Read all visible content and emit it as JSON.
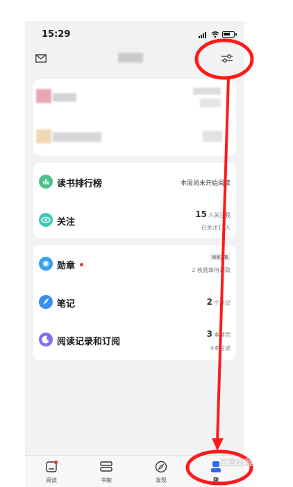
{
  "status_bar": {
    "time": "15:29"
  },
  "header": {
    "mail_icon": "mail-icon",
    "settings_icon": "settings-sliders-icon"
  },
  "menu_card_1": [
    {
      "label": "读书排行榜",
      "icon": "ranking-icon",
      "icon_color": "#4cc38a",
      "right_text": "本周尚未开始阅读"
    },
    {
      "label": "关注",
      "icon": "eye-icon",
      "icon_color": "#3ec9b6",
      "right_number": "15",
      "right_unit": "人关注我",
      "right_sub": "已关注13人"
    }
  ],
  "menu_card_2": [
    {
      "label": "勋章",
      "icon": "medal-icon",
      "icon_color": "#3aa0f0",
      "badge": "阅读天数",
      "right_sub": "2 枚勋章待领取",
      "has_red_dot": true
    },
    {
      "label": "笔记",
      "icon": "feather-icon",
      "icon_color": "#3b8ef0",
      "right_number": "2",
      "right_unit": "个笔记"
    },
    {
      "label": "阅读记录和订阅",
      "icon": "moon-icon",
      "icon_color": "#8a6cf0",
      "right_number": "3",
      "right_unit": "本读完",
      "right_sub": "4本在读"
    }
  ],
  "tab_bar": [
    {
      "label": "阅读",
      "icon": "reading-tablet-icon"
    },
    {
      "label": "书架",
      "icon": "bookshelf-icon"
    },
    {
      "label": "发现",
      "icon": "compass-icon"
    },
    {
      "label": "我",
      "icon": "profile-icon",
      "active": true
    }
  ],
  "colors": {
    "annotation": "#ff1a1a",
    "accent_active": "#2b6cf2",
    "red_dot": "#e13a3a"
  },
  "watermark": "百度经验"
}
